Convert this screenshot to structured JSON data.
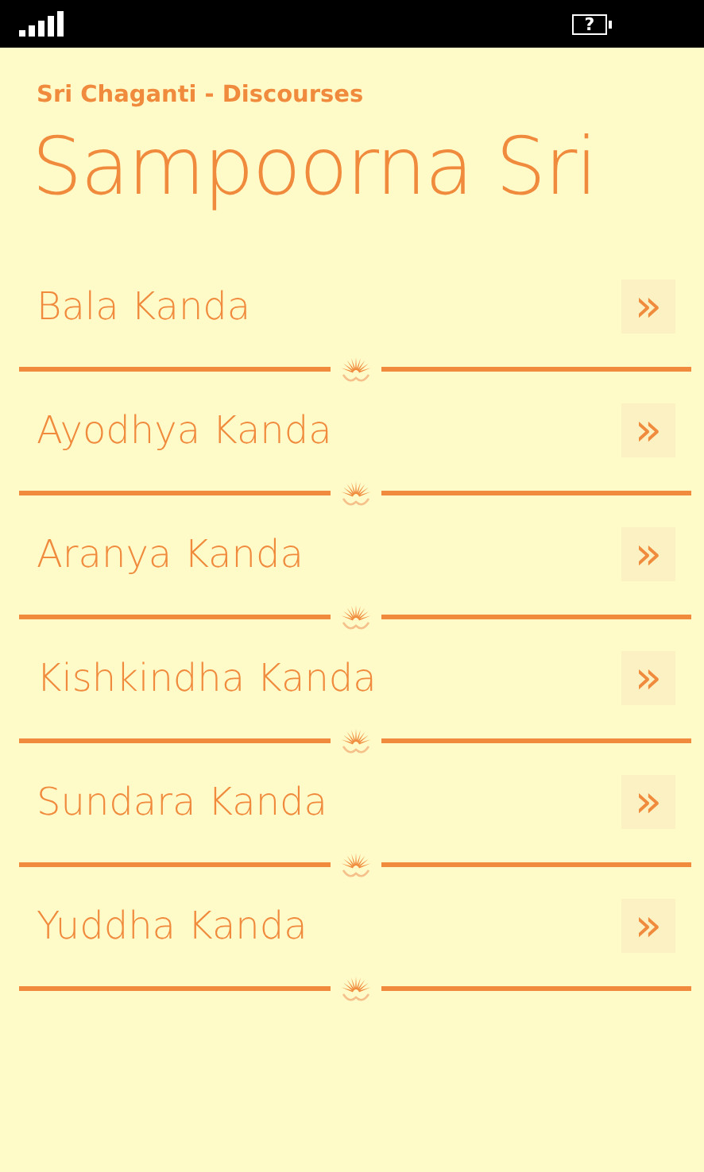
{
  "status_bar": {
    "battery_mark": "?"
  },
  "app_title": "Sri Chaganti - Discourses",
  "page_title": "Sampoorna Sri",
  "items": [
    {
      "label": "Bala Kanda",
      "arrow": "»"
    },
    {
      "label": "Ayodhya Kanda",
      "arrow": "»"
    },
    {
      "label": "Aranya Kanda",
      "arrow": "»"
    },
    {
      "label": "Kishkindha Kanda",
      "arrow": "»"
    },
    {
      "label": "Sundara Kanda",
      "arrow": "»"
    },
    {
      "label": "Yuddha Kanda",
      "arrow": "»"
    }
  ]
}
